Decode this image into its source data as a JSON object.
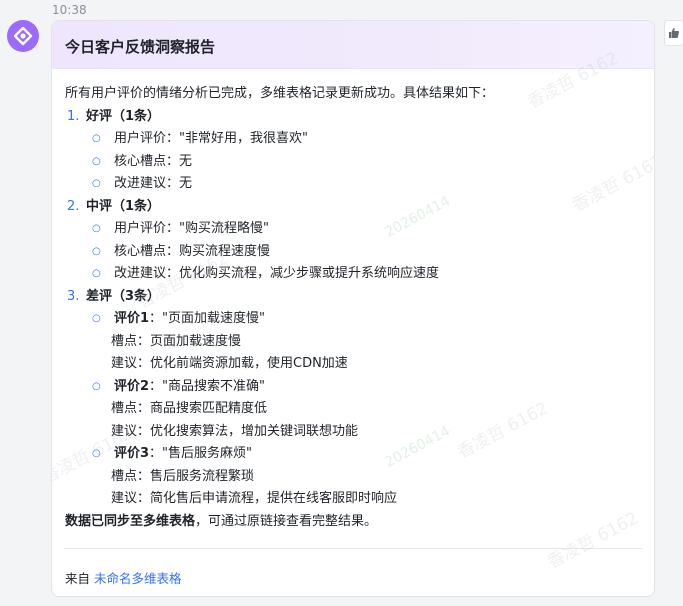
{
  "time": "10:38",
  "card": {
    "title": "今日客户反馈洞察报告",
    "intro": "所有用户评价的情绪分析已完成，多维表格记录更新成功。具体结果如下：",
    "sections": [
      {
        "num": "1.",
        "head": "好评（1条）",
        "items": [
          {
            "text": "用户评价：\"非常好用，我很喜欢\""
          },
          {
            "text": "核心槽点：无"
          },
          {
            "text": "改进建议：无"
          }
        ]
      },
      {
        "num": "2.",
        "head": "中评（1条）",
        "items": [
          {
            "text": "用户评价：\"购买流程略慢\""
          },
          {
            "text": "核心槽点：购买流程速度慢"
          },
          {
            "text": "改进建议：优化购买流程，减少步骤或提升系统响应速度"
          }
        ]
      },
      {
        "num": "3.",
        "head": "差评（3条）",
        "reviews": [
          {
            "label": "评价1",
            "quote": "：\"页面加载速度慢\"",
            "pain": "槽点：页面加载速度慢",
            "suggest": "建议：优化前端资源加载，使用CDN加速"
          },
          {
            "label": "评价2",
            "quote": "：\"商品搜索不准确\"",
            "pain": "槽点：商品搜索匹配精度低",
            "suggest": "建议：优化搜索算法，增加关键词联想功能"
          },
          {
            "label": "评价3",
            "quote": "：\"售后服务麻烦\"",
            "pain": "槽点：售后服务流程繁琐",
            "suggest": "建议：简化售后申请流程，提供在线客服即时响应"
          }
        ]
      }
    ],
    "outro_bold": "数据已同步至多维表格",
    "outro_rest": "，可通过原链接查看完整结果。",
    "source_label": "来自",
    "source_link": "未命名多维表格"
  },
  "watermark": {
    "name": "香凌哲 6162",
    "code": "20260414"
  },
  "icons": {
    "avatar": "bot-logo-icon",
    "thumb": "thumbs-up-icon"
  },
  "colors": {
    "accent": "#3370ff",
    "avatar": "#9b6bff",
    "header_bg": "#efe6fe"
  }
}
